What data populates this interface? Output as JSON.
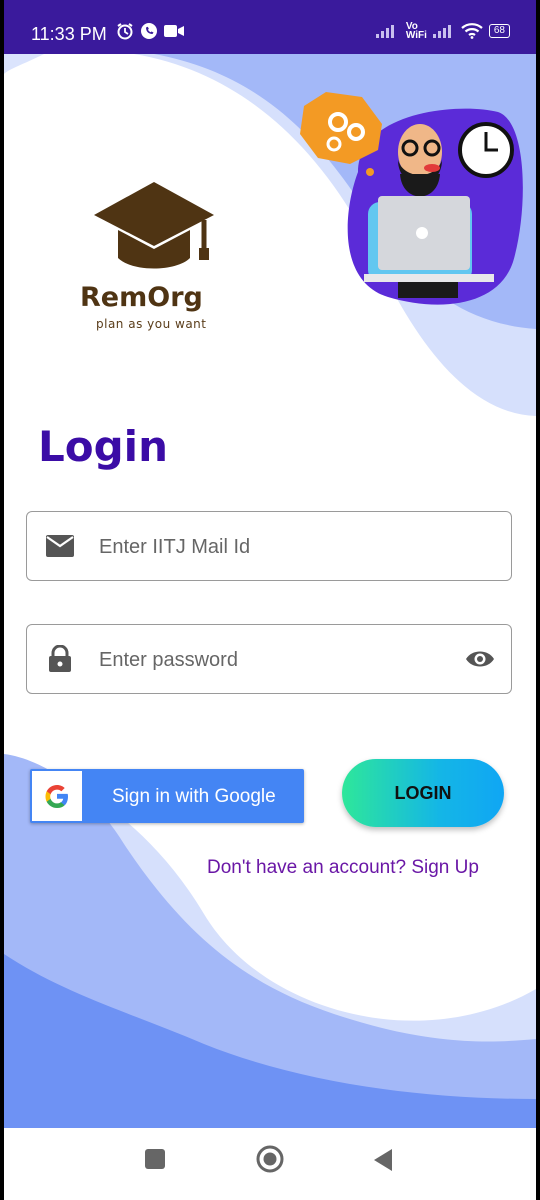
{
  "status_bar": {
    "time": "11:33 PM",
    "network_label_top": "Vo",
    "network_label_bottom": "WiFi",
    "battery": "68"
  },
  "logo": {
    "name": "RemOrg",
    "tagline": "plan as you want"
  },
  "login": {
    "title": "Login",
    "email_placeholder": "Enter IITJ Mail Id",
    "password_placeholder": "Enter password",
    "google_button": "Sign in with Google",
    "login_button": "LOGIN",
    "signup_link": "Don't have an account? Sign Up"
  },
  "colors": {
    "status_bar": "#3a1a9c",
    "title": "#3b0ca6",
    "google_blue": "#4485f4",
    "wave_light": "#d6e0fc",
    "wave_mid": "#a3b8f8",
    "wave_dark": "#6e92f4",
    "signup": "#6a17a6"
  },
  "icons": {
    "email": "mail-icon",
    "password": "lock-icon",
    "visibility": "eye-icon",
    "google": "google-g-icon",
    "nav_recent": "square-icon",
    "nav_home": "circle-icon",
    "nav_back": "triangle-back-icon"
  }
}
